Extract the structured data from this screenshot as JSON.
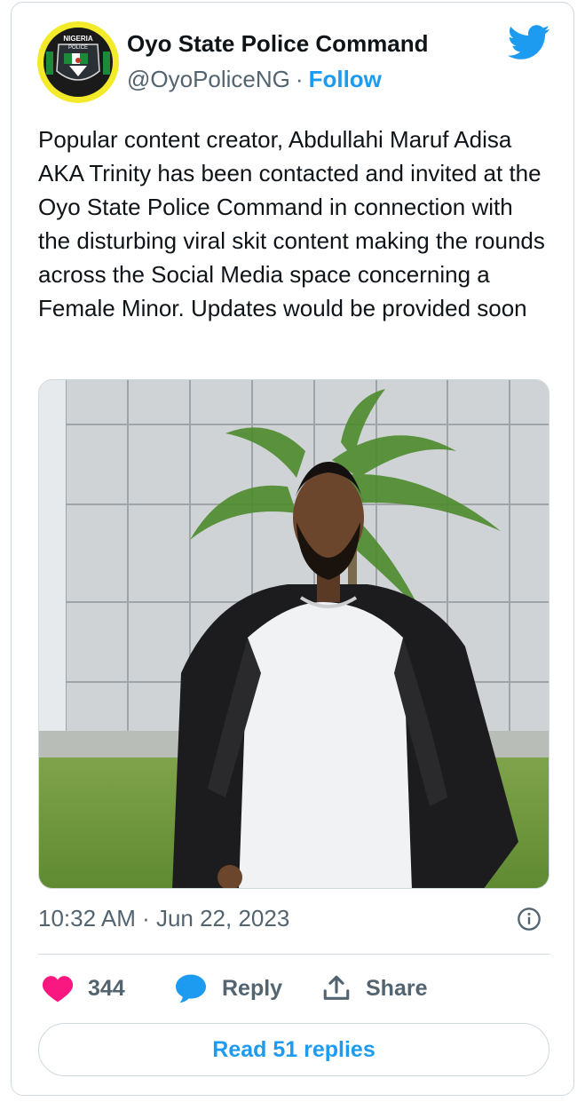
{
  "author": {
    "name": "Oyo State Police Command",
    "handle": "@OyoPoliceNG",
    "separator": "·",
    "follow_label": "Follow",
    "avatar_icon": "nigeria-police-badge",
    "avatar_text_top": "NIGERIA",
    "avatar_text_mid": "POLICE"
  },
  "tweet": {
    "text": "Popular content creator, Abdullahi Maruf Adisa AKA Trinity has been contacted and invited at the Oyo State Police Command in connection with the disturbing viral skit content making the rounds across the Social Media space concerning a Female Minor. Updates would be provided soon",
    "timestamp": "10:32 AM · Jun 22, 2023"
  },
  "actions": {
    "like_count": "344",
    "reply_label": "Reply",
    "share_label": "Share"
  },
  "footer": {
    "read_replies_label": "Read 51 replies"
  },
  "colors": {
    "accent": "#1d9bf0",
    "like": "#f91880",
    "muted": "#536471",
    "border": "#cfd9de"
  },
  "icons": [
    "twitter-bird-icon",
    "info-icon",
    "heart-icon",
    "reply-bubble-icon",
    "share-icon"
  ]
}
